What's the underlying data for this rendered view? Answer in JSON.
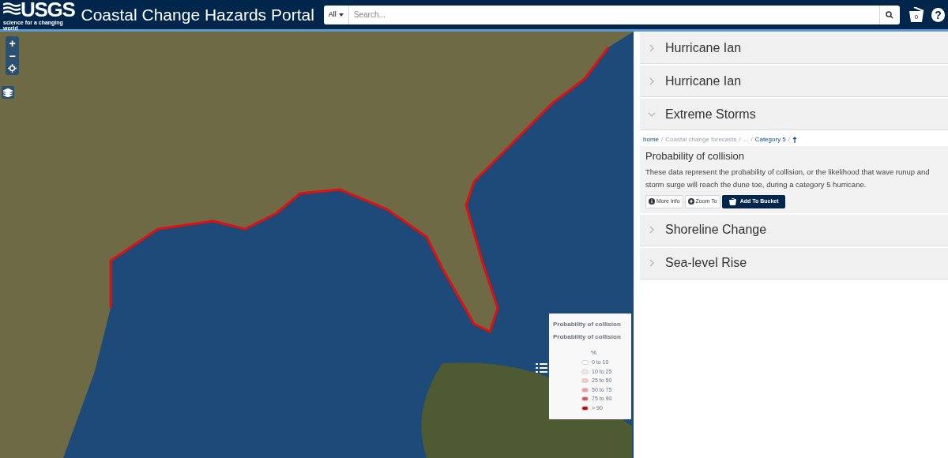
{
  "header": {
    "logo": "USGS",
    "tagline": "science for a changing world",
    "title": "Coastal Change Hazards Portal",
    "search": {
      "filter": "All",
      "placeholder": "Search..."
    },
    "bucket_count": "0",
    "help": "?"
  },
  "map": {
    "zoom_in": "+",
    "zoom_out": "−",
    "legend": {
      "title": "Probability of collision",
      "subtitle": "Probability of collision",
      "unit": "%",
      "items": [
        {
          "label": "0 to 10",
          "color": "#ffffff"
        },
        {
          "label": "10 to 25",
          "color": "#fbe3e3"
        },
        {
          "label": "25 to 50",
          "color": "#f7c9c9"
        },
        {
          "label": "50 to 75",
          "color": "#f29a9a"
        },
        {
          "label": "75 to 90",
          "color": "#ea5050"
        },
        {
          "label": "> 90",
          "color": "#d40000"
        }
      ]
    }
  },
  "panel": [
    {
      "title": "Hurricane Ian",
      "expanded": false
    },
    {
      "title": "Hurricane Ian",
      "expanded": false
    },
    {
      "title": "Extreme Storms",
      "expanded": true,
      "breadcrumb": [
        {
          "text": "home",
          "link": true,
          "separator": "/"
        },
        {
          "text": "Coastal change forecasts",
          "link": false,
          "separator": "/"
        },
        {
          "text": "...",
          "link": false,
          "separator": "/"
        },
        {
          "text": "Category 5",
          "link": true,
          "separator": "/"
        }
      ],
      "item": {
        "title": "Probability of collision",
        "description": "These data represent the probability of collision, or the likelihood that wave runup and storm surge will reach the dune toe, during a category 5 hurricane.",
        "buttons": [
          {
            "label": "More Info",
            "kind": "info"
          },
          {
            "label": "Zoom To",
            "kind": "zoom"
          },
          {
            "label": "Add To Bucket",
            "kind": "bucket"
          }
        ]
      }
    },
    {
      "title": "Shoreline Change",
      "expanded": false
    },
    {
      "title": "Sea-level Rise",
      "expanded": false
    }
  ]
}
